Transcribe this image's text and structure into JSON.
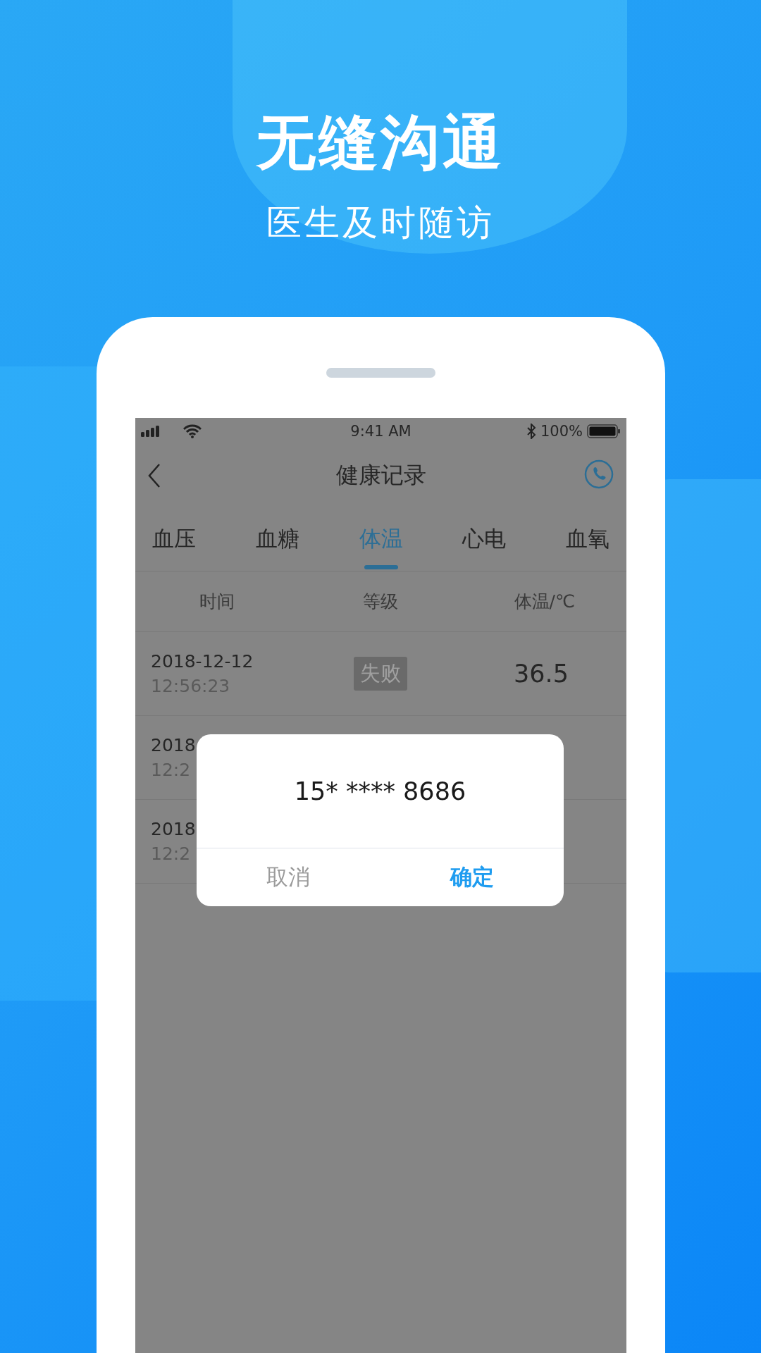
{
  "headline": "无缝沟通",
  "subheadline": "医生及时随访",
  "status_bar": {
    "time": "9:41 AM",
    "battery": "100%"
  },
  "nav": {
    "title": "健康记录"
  },
  "tabs": [
    {
      "label": "血压",
      "selected": false
    },
    {
      "label": "血糖",
      "selected": false
    },
    {
      "label": "体温",
      "selected": true
    },
    {
      "label": "心电",
      "selected": false
    },
    {
      "label": "血氧",
      "selected": false
    }
  ],
  "table": {
    "columns": [
      "时间",
      "等级",
      "体温/℃"
    ],
    "rows": [
      {
        "date": "2018-12-12",
        "time": "12:56:23",
        "grade": "失败",
        "value": "36.5"
      },
      {
        "date": "2018",
        "time": "12:2"
      },
      {
        "date": "2018",
        "time": "12:2"
      }
    ]
  },
  "dialog": {
    "message": "15* **** 8686",
    "buttons": [
      {
        "label": "取消",
        "kind": "cancel"
      },
      {
        "label": "确定",
        "kind": "confirm"
      }
    ]
  }
}
